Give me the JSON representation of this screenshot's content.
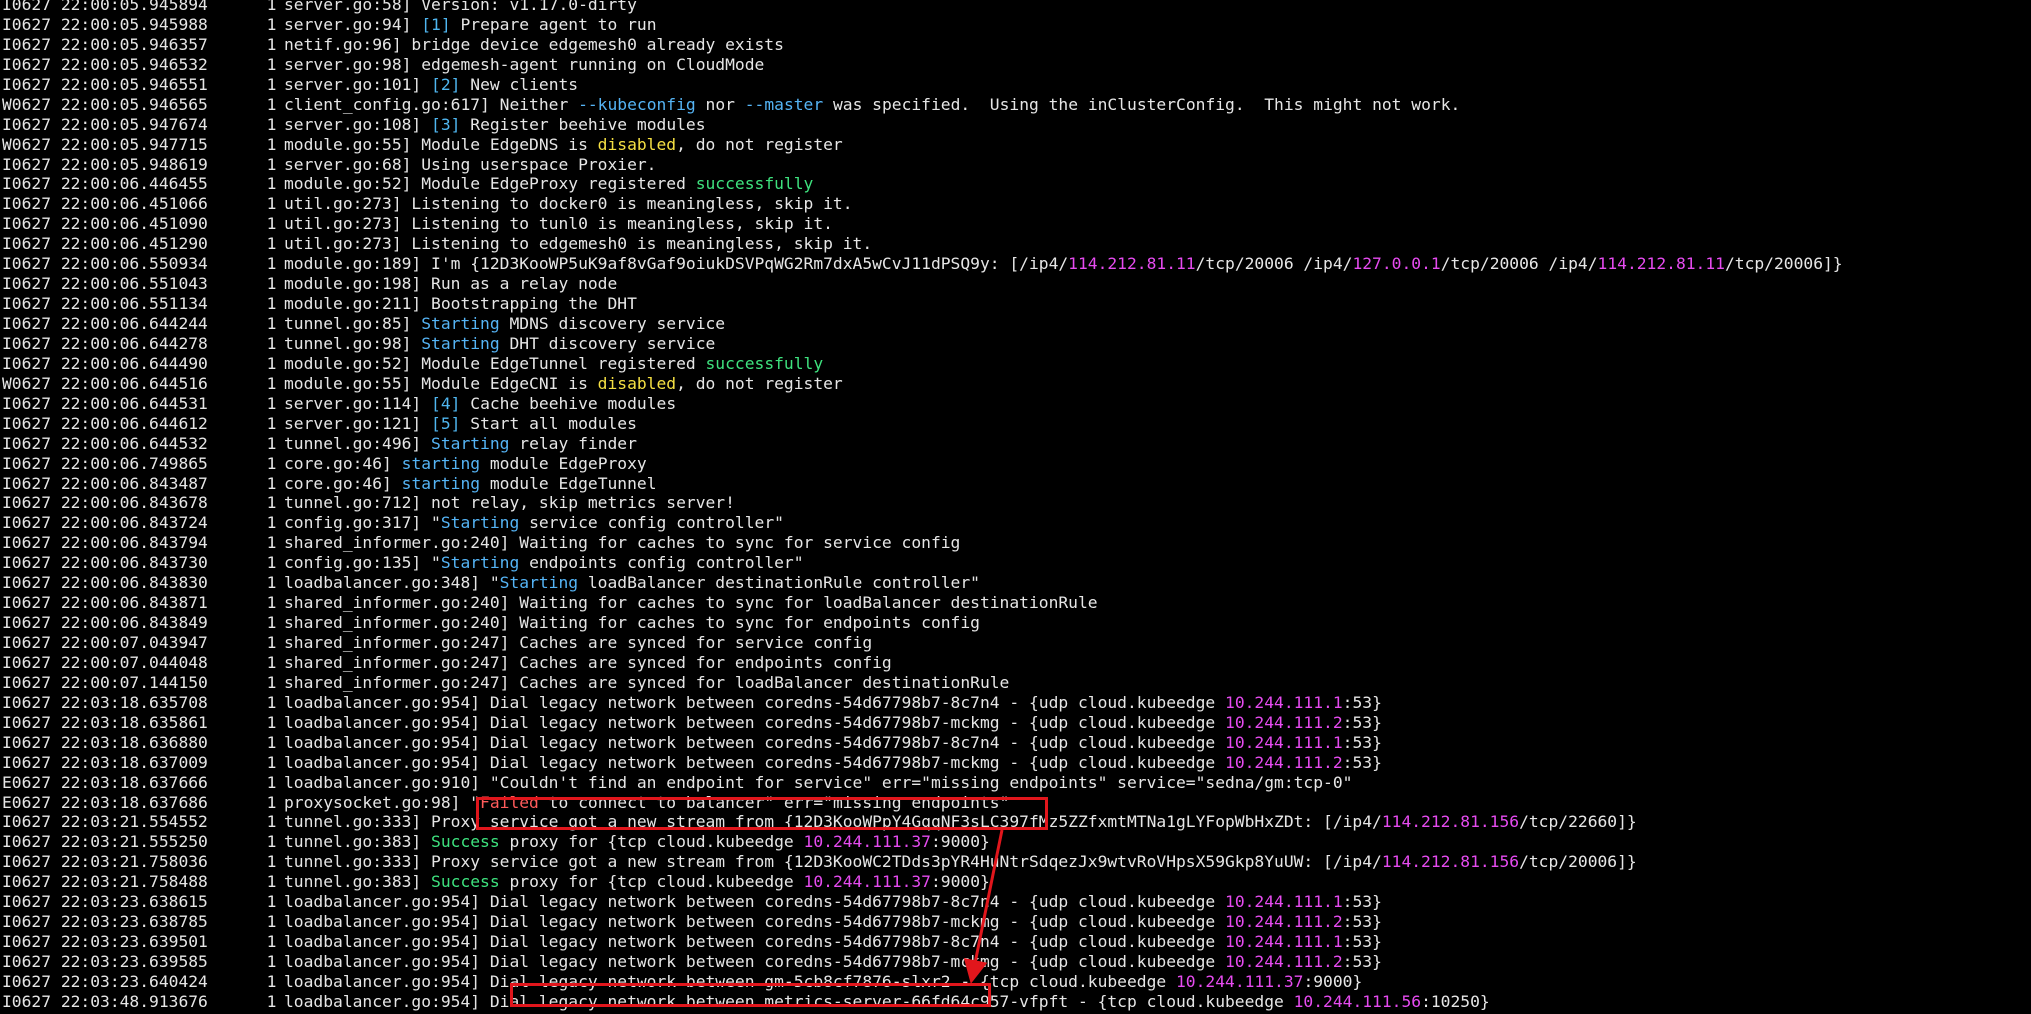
{
  "window": {
    "app": "terminal"
  },
  "colors": {
    "background": "#000000",
    "text": "#e6e6e6",
    "number_tag": "#4fb6f0",
    "warning": "#f5e043",
    "success": "#3ee27e",
    "ip": "#e64bf0",
    "failed": "#ff5b5b",
    "annotation": "#e1161c"
  },
  "lines": [
    {
      "ts": "I0627 22:00:05.945894      1",
      "segs": [
        {
          "t": "server.go:58] Version: v1.17.0-dirty"
        }
      ]
    },
    {
      "ts": "I0627 22:00:05.945988      1",
      "segs": [
        {
          "t": "server.go:94] "
        },
        {
          "t": "[1]",
          "c": "number"
        },
        {
          "t": " Prepare agent to run"
        }
      ]
    },
    {
      "ts": "I0627 22:00:05.946357      1",
      "segs": [
        {
          "t": "netif.go:96] bridge device edgemesh0 already exists"
        }
      ]
    },
    {
      "ts": "I0627 22:00:05.946532      1",
      "segs": [
        {
          "t": "server.go:98] edgemesh-agent running on CloudMode"
        }
      ]
    },
    {
      "ts": "I0627 22:00:05.946551      1",
      "segs": [
        {
          "t": "server.go:101] "
        },
        {
          "t": "[2]",
          "c": "number"
        },
        {
          "t": " New clients"
        }
      ]
    },
    {
      "ts": "W0627 22:00:05.946565      1",
      "segs": [
        {
          "t": "client_config.go:617] Neither "
        },
        {
          "t": "--kubeconfig",
          "c": "flag"
        },
        {
          "t": " nor "
        },
        {
          "t": "--master",
          "c": "flag"
        },
        {
          "t": " was specified.  Using the inClusterConfig.  This might not work."
        }
      ]
    },
    {
      "ts": "I0627 22:00:05.947674      1",
      "segs": [
        {
          "t": "server.go:108] "
        },
        {
          "t": "[3]",
          "c": "number"
        },
        {
          "t": " Register beehive modules"
        }
      ]
    },
    {
      "ts": "W0627 22:00:05.947715      1",
      "segs": [
        {
          "t": "module.go:55] Module EdgeDNS is "
        },
        {
          "t": "disabled",
          "c": "warn"
        },
        {
          "t": ", do not register"
        }
      ]
    },
    {
      "ts": "I0627 22:00:05.948619      1",
      "segs": [
        {
          "t": "server.go:68] Using userspace Proxier."
        }
      ]
    },
    {
      "ts": "I0627 22:00:06.446455      1",
      "segs": [
        {
          "t": "module.go:52] Module EdgeProxy registered "
        },
        {
          "t": "successfully",
          "c": "ok"
        }
      ]
    },
    {
      "ts": "I0627 22:00:06.451066      1",
      "segs": [
        {
          "t": "util.go:273] Listening to docker0 is meaningless, skip it."
        }
      ]
    },
    {
      "ts": "I0627 22:00:06.451090      1",
      "segs": [
        {
          "t": "util.go:273] Listening to tunl0 is meaningless, skip it."
        }
      ]
    },
    {
      "ts": "I0627 22:00:06.451290      1",
      "segs": [
        {
          "t": "util.go:273] Listening to edgemesh0 is meaningless, skip it."
        }
      ]
    },
    {
      "ts": "I0627 22:00:06.550934      1",
      "segs": [
        {
          "t": "module.go:189] I'm {12D3KooWP5uK9af8vGaf9oiukDSVPqWG2Rm7dxA5wCvJ11dPSQ9y: [/ip4/"
        },
        {
          "t": "114.212.81.11",
          "c": "ip"
        },
        {
          "t": "/tcp/20006 /ip4/"
        },
        {
          "t": "127.0.0.1",
          "c": "ip"
        },
        {
          "t": "/tcp/20006 /ip4/"
        },
        {
          "t": "114.212.81.11",
          "c": "ip"
        },
        {
          "t": "/tcp/20006]}"
        }
      ]
    },
    {
      "ts": "I0627 22:00:06.551043      1",
      "segs": [
        {
          "t": "module.go:198] Run as a relay node"
        }
      ]
    },
    {
      "ts": "I0627 22:00:06.551134      1",
      "segs": [
        {
          "t": "module.go:211] Bootstrapping the DHT"
        }
      ]
    },
    {
      "ts": "I0627 22:00:06.644244      1",
      "segs": [
        {
          "t": "tunnel.go:85] "
        },
        {
          "t": "Starting",
          "c": "start"
        },
        {
          "t": " MDNS discovery service"
        }
      ]
    },
    {
      "ts": "I0627 22:00:06.644278      1",
      "segs": [
        {
          "t": "tunnel.go:98] "
        },
        {
          "t": "Starting",
          "c": "start"
        },
        {
          "t": " DHT discovery service"
        }
      ]
    },
    {
      "ts": "I0627 22:00:06.644490      1",
      "segs": [
        {
          "t": "module.go:52] Module EdgeTunnel registered "
        },
        {
          "t": "successfully",
          "c": "ok"
        }
      ]
    },
    {
      "ts": "W0627 22:00:06.644516      1",
      "segs": [
        {
          "t": "module.go:55] Module EdgeCNI is "
        },
        {
          "t": "disabled",
          "c": "warn"
        },
        {
          "t": ", do not register"
        }
      ]
    },
    {
      "ts": "I0627 22:00:06.644531      1",
      "segs": [
        {
          "t": "server.go:114] "
        },
        {
          "t": "[4]",
          "c": "number"
        },
        {
          "t": " Cache beehive modules"
        }
      ]
    },
    {
      "ts": "I0627 22:00:06.644612      1",
      "segs": [
        {
          "t": "server.go:121] "
        },
        {
          "t": "[5]",
          "c": "number"
        },
        {
          "t": " Start all modules"
        }
      ]
    },
    {
      "ts": "I0627 22:00:06.644532      1",
      "segs": [
        {
          "t": "tunnel.go:496] "
        },
        {
          "t": "Starting",
          "c": "start"
        },
        {
          "t": " relay finder"
        }
      ]
    },
    {
      "ts": "I0627 22:00:06.749865      1",
      "segs": [
        {
          "t": "core.go:46] "
        },
        {
          "t": "starting",
          "c": "start"
        },
        {
          "t": " module EdgeProxy"
        }
      ]
    },
    {
      "ts": "I0627 22:00:06.843487      1",
      "segs": [
        {
          "t": "core.go:46] "
        },
        {
          "t": "starting",
          "c": "start"
        },
        {
          "t": " module EdgeTunnel"
        }
      ]
    },
    {
      "ts": "I0627 22:00:06.843678      1",
      "segs": [
        {
          "t": "tunnel.go:712] not relay, skip metrics server!"
        }
      ]
    },
    {
      "ts": "I0627 22:00:06.843724      1",
      "segs": [
        {
          "t": "config.go:317] \""
        },
        {
          "t": "Starting",
          "c": "start"
        },
        {
          "t": " service config controller\""
        }
      ]
    },
    {
      "ts": "I0627 22:00:06.843794      1",
      "segs": [
        {
          "t": "shared_informer.go:240] Waiting for caches to sync for service config"
        }
      ]
    },
    {
      "ts": "I0627 22:00:06.843730      1",
      "segs": [
        {
          "t": "config.go:135] \""
        },
        {
          "t": "Starting",
          "c": "start"
        },
        {
          "t": " endpoints config controller\""
        }
      ]
    },
    {
      "ts": "I0627 22:00:06.843830      1",
      "segs": [
        {
          "t": "loadbalancer.go:348] \""
        },
        {
          "t": "Starting",
          "c": "start"
        },
        {
          "t": " loadBalancer destinationRule controller\""
        }
      ]
    },
    {
      "ts": "I0627 22:00:06.843871      1",
      "segs": [
        {
          "t": "shared_informer.go:240] Waiting for caches to sync for loadBalancer destinationRule"
        }
      ]
    },
    {
      "ts": "I0627 22:00:06.843849      1",
      "segs": [
        {
          "t": "shared_informer.go:240] Waiting for caches to sync for endpoints config"
        }
      ]
    },
    {
      "ts": "I0627 22:00:07.043947      1",
      "segs": [
        {
          "t": "shared_informer.go:247] Caches are synced for service config"
        }
      ]
    },
    {
      "ts": "I0627 22:00:07.044048      1",
      "segs": [
        {
          "t": "shared_informer.go:247] Caches are synced for endpoints config"
        }
      ]
    },
    {
      "ts": "I0627 22:00:07.144150      1",
      "segs": [
        {
          "t": "shared_informer.go:247] Caches are synced for loadBalancer destinationRule"
        }
      ]
    },
    {
      "ts": "I0627 22:03:18.635708      1",
      "segs": [
        {
          "t": "loadbalancer.go:954] Dial legacy network between coredns-54d67798b7-8c7n4 - {udp cloud.kubeedge "
        },
        {
          "t": "10.244.111.1",
          "c": "ip"
        },
        {
          "t": ":53}"
        }
      ]
    },
    {
      "ts": "I0627 22:03:18.635861      1",
      "segs": [
        {
          "t": "loadbalancer.go:954] Dial legacy network between coredns-54d67798b7-mckmg - {udp cloud.kubeedge "
        },
        {
          "t": "10.244.111.2",
          "c": "ip"
        },
        {
          "t": ":53}"
        }
      ]
    },
    {
      "ts": "I0627 22:03:18.636880      1",
      "segs": [
        {
          "t": "loadbalancer.go:954] Dial legacy network between coredns-54d67798b7-8c7n4 - {udp cloud.kubeedge "
        },
        {
          "t": "10.244.111.1",
          "c": "ip"
        },
        {
          "t": ":53}"
        }
      ]
    },
    {
      "ts": "I0627 22:03:18.637009      1",
      "segs": [
        {
          "t": "loadbalancer.go:954] Dial legacy network between coredns-54d67798b7-mckmg - {udp cloud.kubeedge "
        },
        {
          "t": "10.244.111.2",
          "c": "ip"
        },
        {
          "t": ":53}"
        }
      ]
    },
    {
      "ts": "E0627 22:03:18.637666      1",
      "segs": [
        {
          "t": "loadbalancer.go:910] \"Couldn't find an endpoint for service\" err=\"missing endpoints\" service=\"sedna/gm:tcp-0\""
        }
      ]
    },
    {
      "ts": "E0627 22:03:18.637686      1",
      "segs": [
        {
          "t": "proxysocket.go:98] \""
        },
        {
          "t": "Failed",
          "c": "fail"
        },
        {
          "t": " to connect to balancer\" err=\"missing endpoints\""
        }
      ]
    },
    {
      "ts": "I0627 22:03:21.554552      1",
      "segs": [
        {
          "t": "tunnel.go:333] Proxy service got a new stream from {12D3KooWPpY4GqqNF3sLC397fMz5ZZfxmtMTNa1gLYFopWbHxZDt: [/ip4/"
        },
        {
          "t": "114.212.81.156",
          "c": "ip"
        },
        {
          "t": "/tcp/22660]}"
        }
      ]
    },
    {
      "ts": "I0627 22:03:21.555250      1",
      "segs": [
        {
          "t": "tunnel.go:383] "
        },
        {
          "t": "Success",
          "c": "ok"
        },
        {
          "t": " proxy for {tcp cloud.kubeedge "
        },
        {
          "t": "10.244.111.37",
          "c": "ip"
        },
        {
          "t": ":9000}"
        }
      ]
    },
    {
      "ts": "I0627 22:03:21.758036      1",
      "segs": [
        {
          "t": "tunnel.go:333] Proxy service got a new stream from {12D3KooWC2TDds3pYR4HuNtrSdqezJx9wtvRoVHpsX59Gkp8YuUW: [/ip4/"
        },
        {
          "t": "114.212.81.156",
          "c": "ip"
        },
        {
          "t": "/tcp/20006]}"
        }
      ]
    },
    {
      "ts": "I0627 22:03:21.758488      1",
      "segs": [
        {
          "t": "tunnel.go:383] "
        },
        {
          "t": "Success",
          "c": "ok"
        },
        {
          "t": " proxy for {tcp cloud.kubeedge "
        },
        {
          "t": "10.244.111.37",
          "c": "ip"
        },
        {
          "t": ":9000}"
        }
      ]
    },
    {
      "ts": "I0627 22:03:23.638615      1",
      "segs": [
        {
          "t": "loadbalancer.go:954] Dial legacy network between coredns-54d67798b7-8c7n4 - {udp cloud.kubeedge "
        },
        {
          "t": "10.244.111.1",
          "c": "ip"
        },
        {
          "t": ":53}"
        }
      ]
    },
    {
      "ts": "I0627 22:03:23.638785      1",
      "segs": [
        {
          "t": "loadbalancer.go:954] Dial legacy network between coredns-54d67798b7-mckmg - {udp cloud.kubeedge "
        },
        {
          "t": "10.244.111.2",
          "c": "ip"
        },
        {
          "t": ":53}"
        }
      ]
    },
    {
      "ts": "I0627 22:03:23.639501      1",
      "segs": [
        {
          "t": "loadbalancer.go:954] Dial legacy network between coredns-54d67798b7-8c7n4 - {udp cloud.kubeedge "
        },
        {
          "t": "10.244.111.1",
          "c": "ip"
        },
        {
          "t": ":53}"
        }
      ]
    },
    {
      "ts": "I0627 22:03:23.639585      1",
      "segs": [
        {
          "t": "loadbalancer.go:954] Dial legacy network between coredns-54d67798b7-mckmg - {udp cloud.kubeedge "
        },
        {
          "t": "10.244.111.2",
          "c": "ip"
        },
        {
          "t": ":53}"
        }
      ]
    },
    {
      "ts": "I0627 22:03:23.640424      1",
      "segs": [
        {
          "t": "loadbalancer.go:954] Dial legacy network between gm-5cb8cf7876-slxr2 - {tcp cloud.kubeedge "
        },
        {
          "t": "10.244.111.37",
          "c": "ip"
        },
        {
          "t": ":9000}"
        }
      ]
    },
    {
      "ts": "I0627 22:03:48.913676      1",
      "segs": [
        {
          "t": "loadbalancer.go:954] Dial legacy network between metrics-server-66fd64c957-vfpft - {tcp cloud.kubeedge "
        },
        {
          "t": "10.244.111.56",
          "c": "ip"
        },
        {
          "t": ":10250}"
        }
      ]
    }
  ]
}
